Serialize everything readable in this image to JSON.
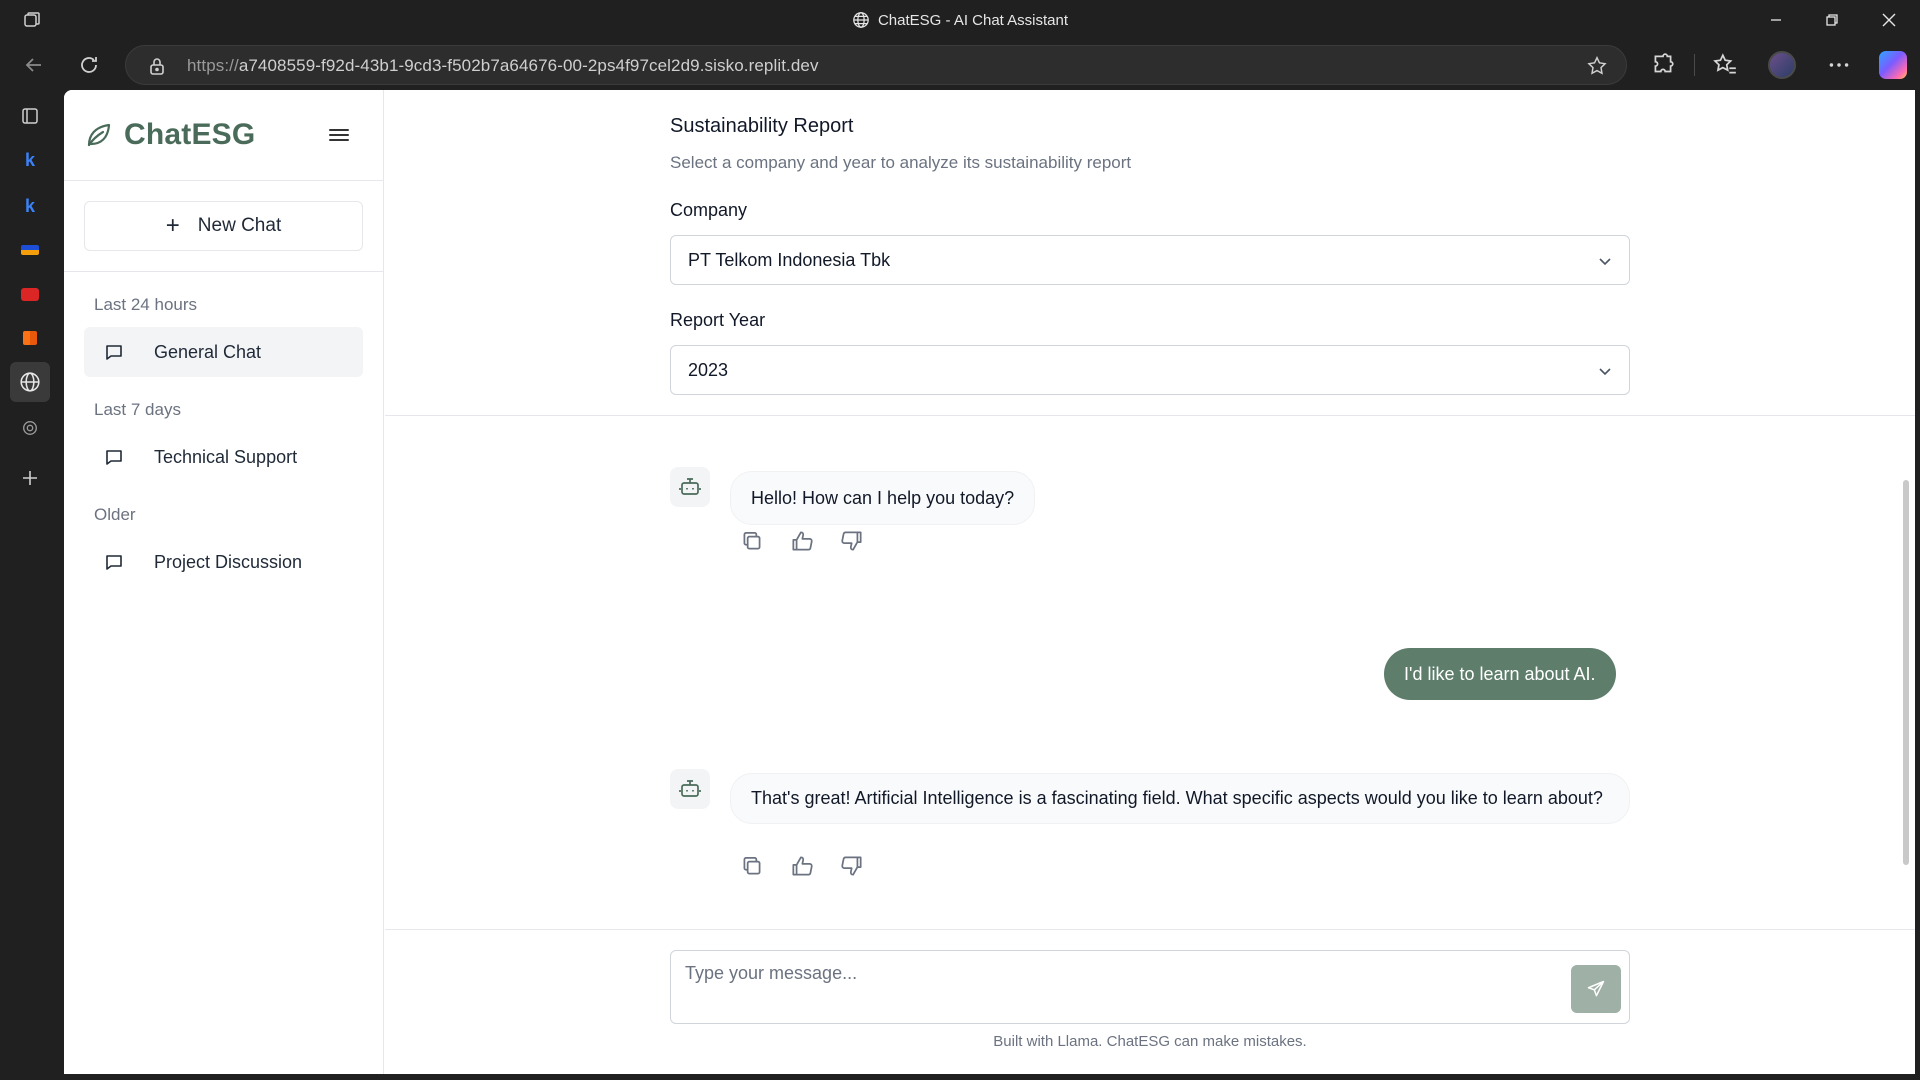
{
  "browser": {
    "window_title": "ChatESG - AI Chat Assistant",
    "url_proto": "https://",
    "url_rest": "a7408559-f92d-43b1-9cd3-f502b7a64676-00-2ps4f97cel2d9.sisko.replit.dev",
    "vertical_tabs": [
      "tabs-icon",
      "k-icon",
      "k-icon",
      "flag-icon",
      "youtube-icon",
      "app-icon",
      "globe-icon",
      "openai-icon",
      "plus-icon"
    ]
  },
  "sidebar": {
    "brand": "ChatESG",
    "new_chat_label": "New Chat",
    "groups": [
      {
        "label": "Last 24 hours",
        "items": [
          {
            "label": "General Chat",
            "active": true
          }
        ]
      },
      {
        "label": "Last 7 days",
        "items": [
          {
            "label": "Technical Support",
            "active": false
          }
        ]
      },
      {
        "label": "Older",
        "items": [
          {
            "label": "Project Discussion",
            "active": false
          }
        ]
      }
    ]
  },
  "report": {
    "title": "Sustainability Report",
    "subtitle": "Select a company and year to analyze its sustainability report",
    "company_label": "Company",
    "company_value": "PT Telkom Indonesia Tbk",
    "year_label": "Report Year",
    "year_value": "2023"
  },
  "messages": [
    {
      "role": "assistant",
      "text": "Hello! How can I help you today?"
    },
    {
      "role": "user",
      "text": "I'd like to learn about AI."
    },
    {
      "role": "assistant",
      "text": "That's great! Artificial Intelligence is a fascinating field. What specific aspects would you like to learn about?"
    }
  ],
  "composer": {
    "placeholder": "Type your message...",
    "footer": "Built with Llama. ChatESG can make mistakes."
  },
  "colors": {
    "brand_green": "#4a6b5a",
    "user_bubble": "#5e7d6b",
    "send_button": "#9fb0a6"
  }
}
